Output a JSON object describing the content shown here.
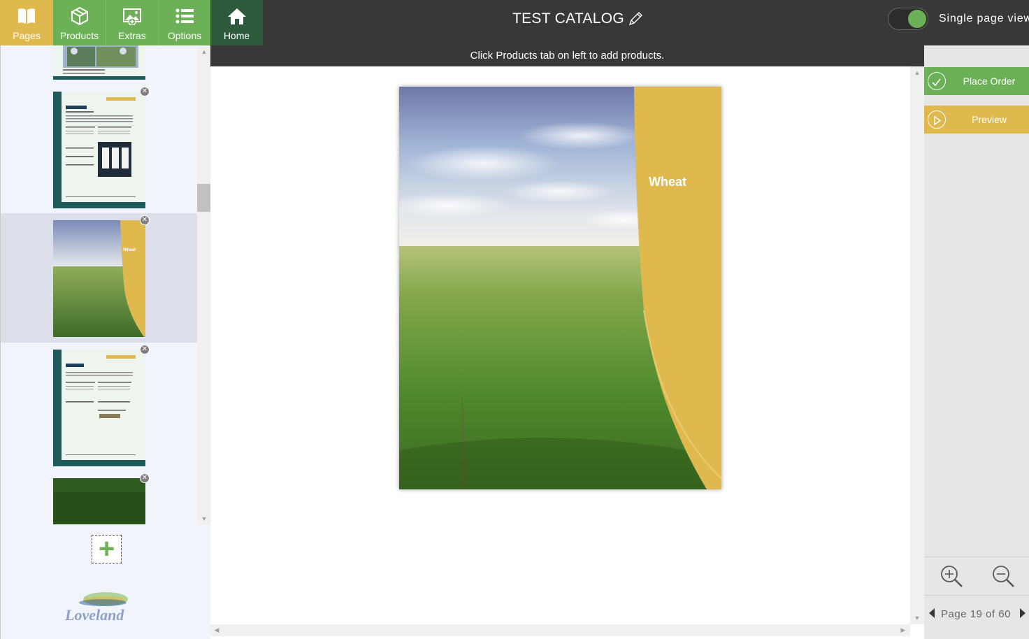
{
  "toolbar": {
    "tabs": [
      {
        "label": "Pages",
        "icon": "book-icon"
      },
      {
        "label": "Products",
        "icon": "box-icon"
      },
      {
        "label": "Extras",
        "icon": "image-add-icon"
      },
      {
        "label": "Options",
        "icon": "list-icon"
      },
      {
        "label": "Home",
        "icon": "home-icon"
      }
    ],
    "title": "TEST CATALOG",
    "view_toggle_label": "Single page view",
    "view_toggle_on": true
  },
  "message": "Click Products tab on left to add products.",
  "page_preview": {
    "heading": "Wheat"
  },
  "sidebar": {
    "thumbnails": [
      {
        "name": "page-thumbnail-17",
        "kind": "product",
        "brand": "WARHAWK"
      },
      {
        "name": "page-thumbnail-18",
        "kind": "product",
        "brand": "WARHAWK"
      },
      {
        "name": "page-thumbnail-19",
        "kind": "cover",
        "heading": "Wheat",
        "selected": true
      },
      {
        "name": "page-thumbnail-20",
        "kind": "product",
        "brand": "ANARCHY"
      },
      {
        "name": "page-thumbnail-21",
        "kind": "grass"
      }
    ],
    "logo_text": "Loveland"
  },
  "actions": {
    "place_order": "Place Order",
    "preview": "Preview"
  },
  "pager": {
    "text": "Page 19 of 60",
    "current": 19,
    "total": 60
  },
  "colors": {
    "gold": "#e0b94e",
    "green": "#6cb158",
    "dark": "#383838",
    "home_green": "#2d5a3d"
  }
}
